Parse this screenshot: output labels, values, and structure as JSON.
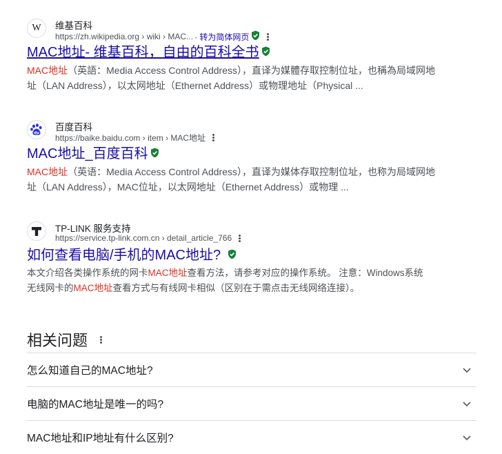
{
  "results": [
    {
      "site_name": "维基百科",
      "url": "https://zh.wikipedia.org › wiki › MAC...",
      "translate": "· 转为简体网页",
      "title": "MAC地址- 维基百科，自由的百科全书",
      "favicon": "wikipedia-icon",
      "snippet_line1_hl": "MAC地址",
      "snippet_line1_rest": "（英語：Media Access Control Address），直译为媒體存取控制位址，也稱為局域网地",
      "snippet_line2": "址（LAN Address），以太网地址（Ethernet Address）或物理地址（Physical ..."
    },
    {
      "site_name": "百度百科",
      "url": "https://baike.baidu.com › item › MAC地址",
      "title": "MAC地址_百度百科",
      "favicon": "baidu-paw-icon",
      "snippet_line1_hl": "MAC地址",
      "snippet_line1_rest": "（英语：Media Access Control Address），直译为媒体存取控制位址，也称为局域网地",
      "snippet_line2": "址（LAN Address），MAC位址，以太网地址（Ethernet Address）或物理 ..."
    },
    {
      "site_name": "TP-LINK 服务支持",
      "url": "https://service.tp-link.com.cn › detail_article_766",
      "title": "如何查看电脑/手机的MAC地址?",
      "favicon": "tplink-icon",
      "snippet_line1_pre": "本文介绍各类操作系统的网卡",
      "snippet_line1_hl": "MAC地址",
      "snippet_line1_post": "查看方法，请参考对应的操作系统。 注意：Windows系统",
      "snippet_line2_pre": "无线网卡的",
      "snippet_line2_hl": "MAC地址",
      "snippet_line2_post": "查看方式与有线网卡相似（区别在于需点击无线网络连接）。"
    }
  ],
  "related": {
    "heading": "相关问题",
    "questions": [
      "怎么知道自己的MAC地址?",
      "电脑的MAC地址是唯一的吗?",
      "MAC地址和IP地址有什么区别?"
    ]
  },
  "colors": {
    "link": "#1a0dab",
    "highlight": "#d93025",
    "url_text": "#4d5156",
    "verified": "#188038"
  }
}
